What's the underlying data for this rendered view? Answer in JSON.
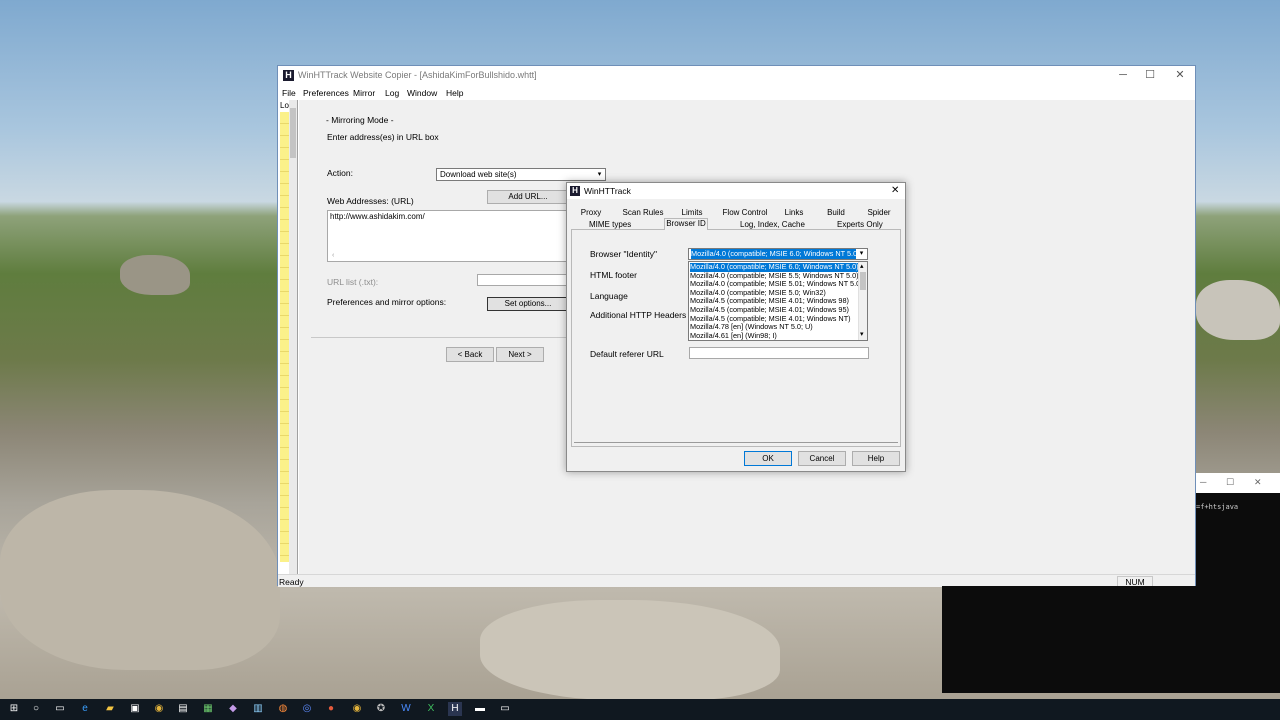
{
  "main_window": {
    "title": "WinHTTrack Website Copier - [AshidaKimForBullshido.whtt]",
    "app_icon_letter": "H",
    "controls": {
      "minimize": "─",
      "maximize": "☐",
      "close": "✕"
    },
    "menu": [
      "File",
      "Preferences",
      "Mirror",
      "Log",
      "Window",
      "Help"
    ],
    "left_pane_header": "Lo",
    "mirroring_mode": "- Mirroring Mode -",
    "instruction": "Enter address(es) in URL box",
    "action_label": "Action:",
    "action_value": "Download web site(s)",
    "web_addresses_label": "Web Addresses: (URL)",
    "add_url_button": "Add URL...",
    "url_text": "http://www.ashidakim.com/",
    "url_list_label": "URL list (.txt):",
    "prefs_label": "Preferences and mirror options:",
    "set_options_button": "Set options...",
    "back_button": "< Back",
    "next_button": "Next >",
    "status_ready": "Ready",
    "status_num": "NUM"
  },
  "dialog": {
    "title": "WinHTTrack",
    "icon_letter": "H",
    "close": "✕",
    "tabs_row1": [
      "Proxy",
      "Scan Rules",
      "Limits",
      "Flow Control",
      "Links",
      "Build",
      "Spider"
    ],
    "tabs_row2": [
      "MIME types",
      "Browser ID",
      "Log, Index, Cache",
      "Experts Only"
    ],
    "active_tab": "Browser ID",
    "browser_identity_label": "Browser \"Identity\"",
    "browser_identity_value": "Mozilla/4.0 (compatible; MSIE 6.0; Windows NT 5.0)",
    "html_footer_label": "HTML footer",
    "language_label": "Language",
    "http_headers_label": "Additional HTTP Headers",
    "referer_label": "Default referer URL",
    "dropdown_items": [
      "Mozilla/4.0 (compatible; MSIE 6.0; Windows NT 5.0)",
      "Mozilla/4.0 (compatible; MSIE 5.5; Windows NT 5.0)",
      "Mozilla/4.0 (compatible; MSIE 5.01; Windows NT 5.0)",
      "Mozilla/4.0 (compatible; MSIE 5.0; Win32)",
      "Mozilla/4.5 (compatible; MSIE 4.01; Windows 98)",
      "Mozilla/4.5 (compatible; MSIE 4.01; Windows 95)",
      "Mozilla/4.5 (compatible; MSIE 4.01; Windows NT)",
      "Mozilla/4.78 [en] (Windows NT 5.0; U)",
      "Mozilla/4.61 [en] (Win98; I)"
    ],
    "selected_index": 0,
    "ok_button": "OK",
    "cancel_button": "Cancel",
    "help_button": "Help"
  },
  "console": {
    "text": "=f+htsjava",
    "controls": {
      "minimize": "─",
      "maximize": "☐",
      "close": "✕"
    }
  },
  "taskbar": {
    "icons": [
      "windows-icon",
      "search-icon",
      "task-view-icon",
      "edge-icon",
      "explorer-icon",
      "store-icon",
      "chrome-icon",
      "app-icon",
      "terminal-icon",
      "app-icon",
      "app-icon",
      "app-icon",
      "app-icon",
      "chrome-icon",
      "app-icon",
      "word-icon",
      "excel-icon",
      "app-icon",
      "httrack-icon",
      "app-icon",
      "app-icon"
    ]
  },
  "colors": {
    "selection": "#0078d7",
    "log_strip": "#fbf18a"
  }
}
